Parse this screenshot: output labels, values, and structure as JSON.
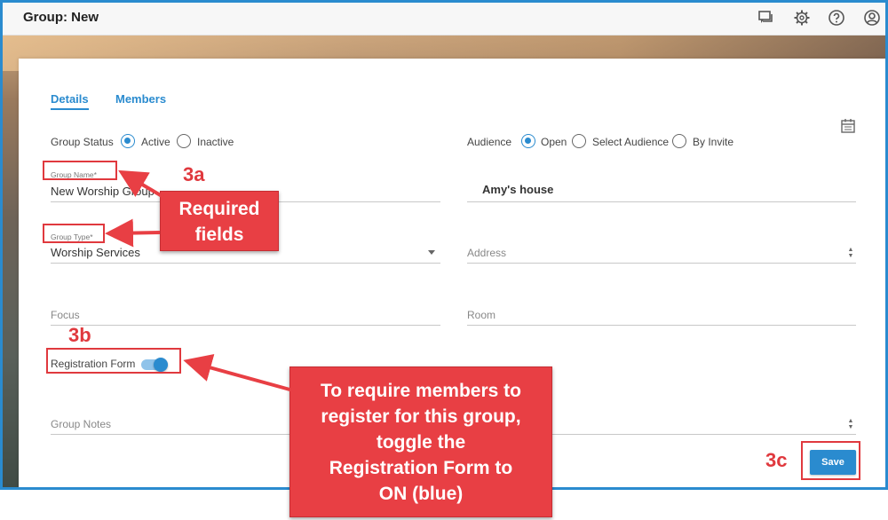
{
  "header": {
    "title": "Group: New",
    "icons": [
      "chat-icon",
      "gear-icon",
      "help-icon",
      "account-icon"
    ]
  },
  "tabs": [
    {
      "label": "Details",
      "active": true
    },
    {
      "label": "Members",
      "active": false
    }
  ],
  "form": {
    "group_status_label": "Group Status",
    "group_status_options": [
      "Active",
      "Inactive"
    ],
    "group_status_selected": "Active",
    "audience_label": "Audience",
    "audience_options": [
      "Open",
      "Select Audience",
      "By Invite"
    ],
    "audience_selected": "Open",
    "group_name_label": "Group Name*",
    "group_name_value": "New Worship Group",
    "location_value": "Amy's house",
    "group_type_label": "Group Type*",
    "group_type_value": "Worship Services",
    "address_placeholder": "Address",
    "focus_placeholder": "Focus",
    "room_placeholder": "Room",
    "registration_form_label": "Registration Form",
    "registration_form_on": true,
    "group_notes_placeholder": "Group Notes",
    "save_label": "Save"
  },
  "annotations": {
    "step_3a": "3a",
    "step_3b": "3b",
    "step_3c": "3c",
    "required_fields_line1": "Required",
    "required_fields_line2": "fields",
    "instruction_lines": [
      "To require members to",
      "register for this group,",
      "toggle the",
      "Registration Form to",
      "ON (blue)"
    ]
  },
  "colors": {
    "accent": "#2a8bcf",
    "annotation_red": "#e83f44"
  }
}
